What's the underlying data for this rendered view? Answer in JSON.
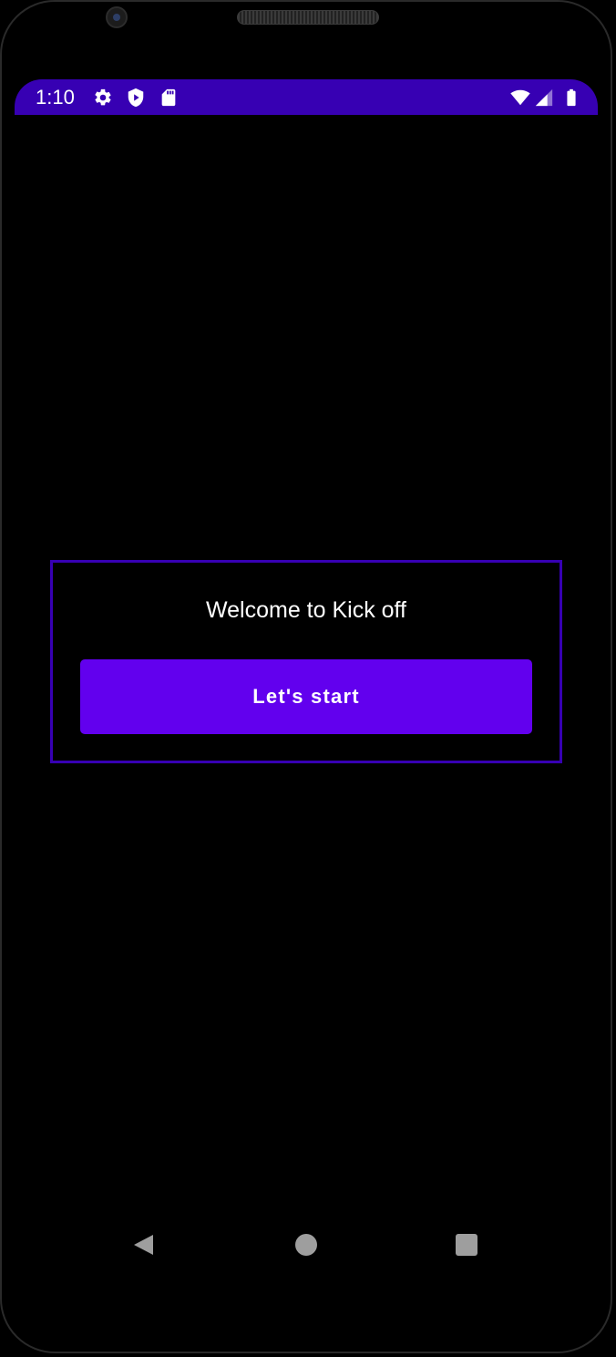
{
  "status_bar": {
    "time": "1:10",
    "left_icons": [
      "gear-icon",
      "shield-play-icon",
      "sd-card-icon"
    ],
    "right_icons": [
      "wifi-icon",
      "cellular-signal-icon",
      "battery-icon"
    ],
    "background_color": "#3700b3"
  },
  "main": {
    "welcome_text": "Welcome to Kick off",
    "start_button_label": "Let's start",
    "button_color": "#6200ee",
    "card_border_color": "#3700b3"
  },
  "nav_bar": {
    "buttons": [
      "back-icon",
      "home-icon",
      "recents-icon"
    ]
  }
}
